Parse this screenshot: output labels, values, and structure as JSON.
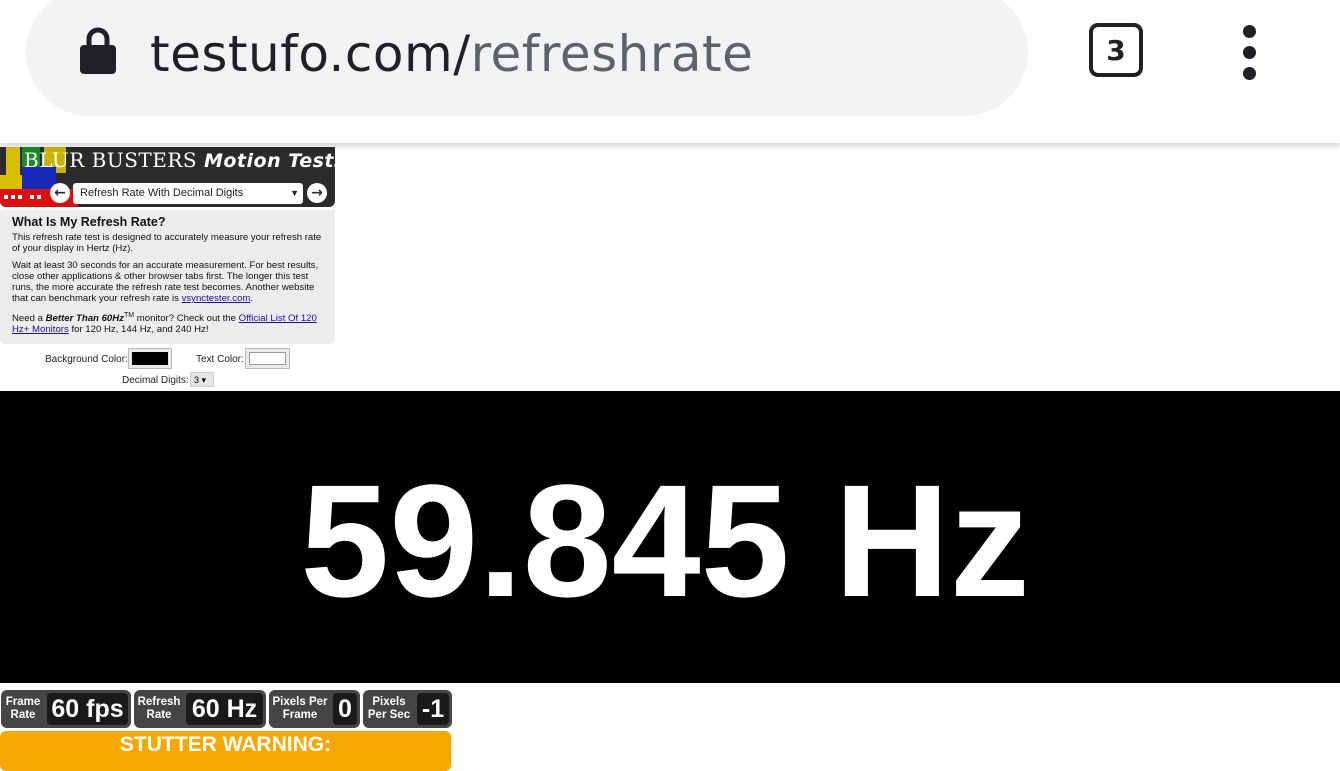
{
  "browser": {
    "url_host": "testufo.com/",
    "url_path": "refreshrate",
    "tab_count": "3",
    "icons": {
      "lock": "lock-icon",
      "menu": "more-vert-icon"
    }
  },
  "header": {
    "logo_main": "BLUR BUSTERS",
    "logo_sub": "Motion Tests",
    "prev_icon": "←",
    "next_icon": "→",
    "test_selected": "Refresh Rate With Decimal Digits"
  },
  "info": {
    "title": "What Is My Refresh Rate?",
    "p1": "This refresh rate test is designed to accurately measure your refresh rate of your display in Hertz (Hz).",
    "p2_text": "Wait at least 30 seconds for an accurate measurement. For best results, close other applications & other browser tabs first. The longer this test runs, the more accurate the refresh rate test becomes. Another website that can benchmark your refresh rate is ",
    "p2_link": "vsynctester.com",
    "p2_end": ".",
    "p3_start": "Need a ",
    "p3_bold": "Better Than 60Hz",
    "p3_tm": "TM",
    "p3_mid": " monitor? Check out the ",
    "p3_link": "Official List Of 120 Hz+ Monitors",
    "p3_end": " for 120 Hz, 144 Hz, and 240 Hz!"
  },
  "options": {
    "bg_label": "Background Color:",
    "bg_color": "#000000",
    "text_label": "Text Color:",
    "text_color": "#ffffff",
    "digits_label": "Decimal Digits:",
    "digits_value": "3 ▾"
  },
  "display": {
    "measurement": "59.845 Hz"
  },
  "stats": [
    {
      "label": "Frame Rate",
      "value": "60 fps"
    },
    {
      "label": "Refresh Rate",
      "value": "60 Hz"
    },
    {
      "label": "Pixels Per Frame",
      "value": "0"
    },
    {
      "label": "Pixels Per Sec",
      "value": "-1"
    }
  ],
  "warning": "STUTTER WARNING:",
  "colors": {
    "warning": "#f5a800",
    "stat_bg": "#454545",
    "display_bg": "#000000"
  }
}
